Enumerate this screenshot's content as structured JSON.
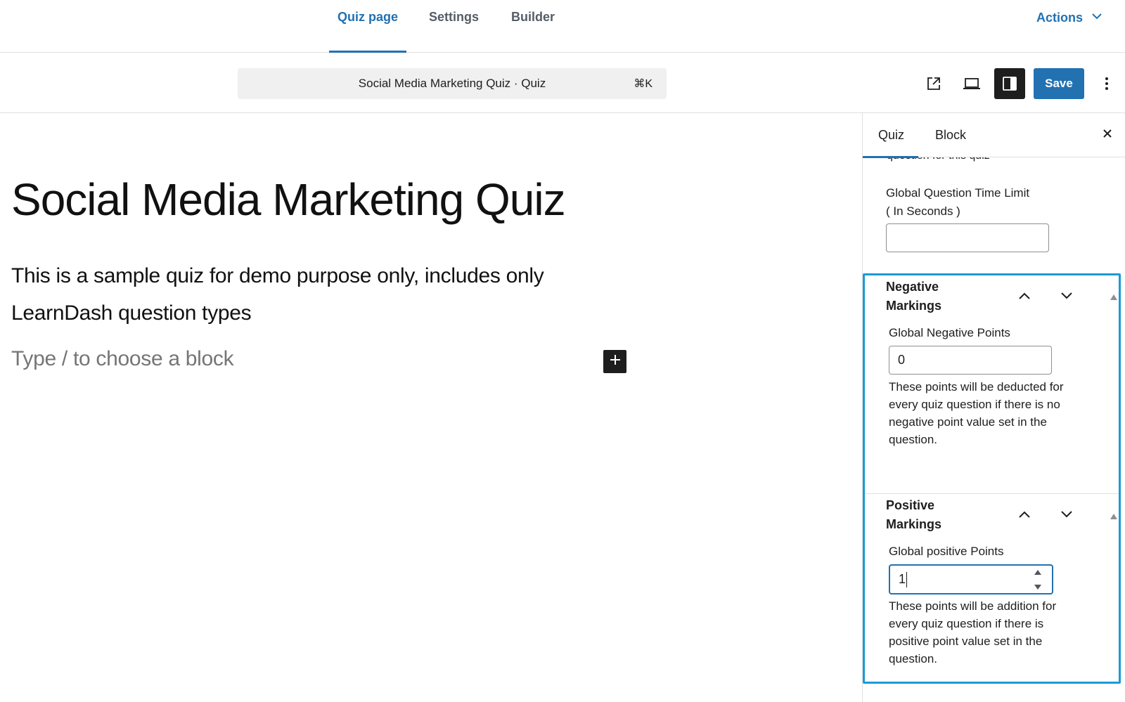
{
  "top_nav": {
    "tabs": [
      {
        "label": "Quiz page",
        "active": true
      },
      {
        "label": "Settings",
        "active": false
      },
      {
        "label": "Builder",
        "active": false
      }
    ],
    "actions_label": "Actions"
  },
  "toolbar": {
    "command_bar_text": "Social Media Marketing Quiz · Quiz",
    "command_shortcut": "⌘K",
    "save_label": "Save",
    "icons": [
      "external-link-icon",
      "desktop-preview-icon",
      "sidebar-toggle-icon",
      "more-options-icon"
    ]
  },
  "editor": {
    "title": "Social Media Marketing Quiz",
    "description_line1": "This is a sample quiz for demo purpose only, includes only",
    "description_line2": "LearnDash question types",
    "block_placeholder": "Type / to choose a block"
  },
  "sidebar": {
    "tabs": [
      {
        "label": "Quiz",
        "active": true
      },
      {
        "label": "Block",
        "active": false
      }
    ],
    "cut_off_text": "question for this quiz",
    "time_limit": {
      "label_line1": "Global Question Time Limit",
      "label_line2": "( In Seconds )",
      "value": ""
    },
    "negative_markings": {
      "title_line1": "Negative",
      "title_line2": "Markings",
      "field_label": "Global Negative Points",
      "value": "0",
      "help_lines": [
        "These points will be deducted for",
        "every quiz question if there is no",
        "negative point value set in the",
        "question."
      ]
    },
    "positive_markings": {
      "title_line1": "Positive",
      "title_line2": "Markings",
      "field_label": "Global positive Points",
      "value": "1",
      "help_lines": [
        "These points will be addition for",
        "every quiz question if there is",
        "positive point value set in the",
        "question."
      ]
    }
  },
  "colors": {
    "accent": "#2271b1",
    "highlight_frame": "#1a9bd7",
    "dark_button": "#1e1e1e"
  }
}
